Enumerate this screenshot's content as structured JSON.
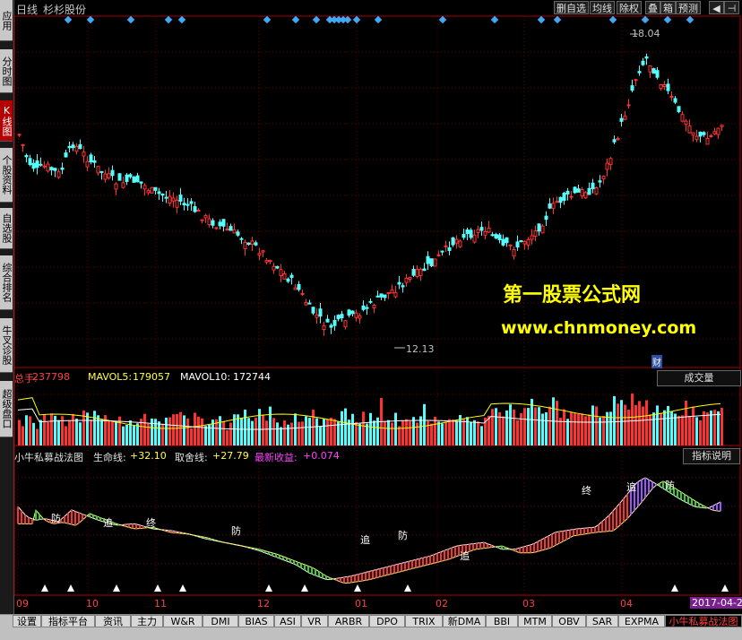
{
  "sidebar": {
    "tabs": [
      {
        "label": "应用",
        "active": false
      },
      {
        "label": "分时图",
        "active": false
      },
      {
        "label": "K线图",
        "active": true
      },
      {
        "label": "个股资料",
        "active": false
      },
      {
        "label": "自选股",
        "active": false
      },
      {
        "label": "综合排名",
        "active": false
      },
      {
        "label": "牛叉诊股",
        "active": false
      },
      {
        "label": "超级盘口",
        "active": false
      }
    ]
  },
  "header": {
    "period": "日线",
    "stock_name": "杉杉股份",
    "buttons": [
      "删自选",
      "均线",
      "除权",
      "叠",
      "箱",
      "预测"
    ]
  },
  "price_chart": {
    "high_label": "18.04",
    "low_label": "12.13",
    "cai_badge": "财"
  },
  "volume_panel": {
    "total_label": "总手:",
    "total_value": "237798",
    "ma5_label": "MAVOL5:",
    "ma5_value": "179057",
    "ma10_label": "MAVOL10:",
    "ma10_value": "172744",
    "dropdown": "成交量"
  },
  "indicator_panel": {
    "name": "小牛私募战法图",
    "life_label": "生命线:",
    "life_value": "+32.10",
    "take_label": "取舍线:",
    "take_value": "+27.79",
    "profit_label": "最新收益:",
    "profit_value": "+0.074",
    "help_button": "指标说明",
    "markers": [
      "防",
      "追",
      "终",
      "防",
      "追",
      "防",
      "追",
      "终",
      "追",
      "防"
    ]
  },
  "x_axis": {
    "labels": [
      "09",
      "10",
      "11",
      "12",
      "01",
      "02",
      "03",
      "04"
    ],
    "date_badge": "2017-04-2"
  },
  "watermark": {
    "line1": "第一股票公式网",
    "line2": "www.chnmoney.com"
  },
  "bottom_tabs": [
    "设置",
    "指标平台",
    "资讯",
    "主力",
    "W&R",
    "DMI",
    "BIAS",
    "ASI",
    "VR",
    "ARBR",
    "DPO",
    "TRIX",
    "新DMA",
    "BBI",
    "MTM",
    "OBV",
    "SAR",
    "EXPMA",
    "小牛私募战法图"
  ],
  "chart_data": {
    "type": "candlestick",
    "price_range": [
      12.13,
      18.04
    ],
    "x_months": [
      "09",
      "10",
      "11",
      "12",
      "01",
      "02",
      "03",
      "04"
    ],
    "colors": {
      "up": "#ff3232",
      "down": "#54fcfc",
      "ma5": "#ffffff",
      "ma10": "#ffff00"
    }
  }
}
